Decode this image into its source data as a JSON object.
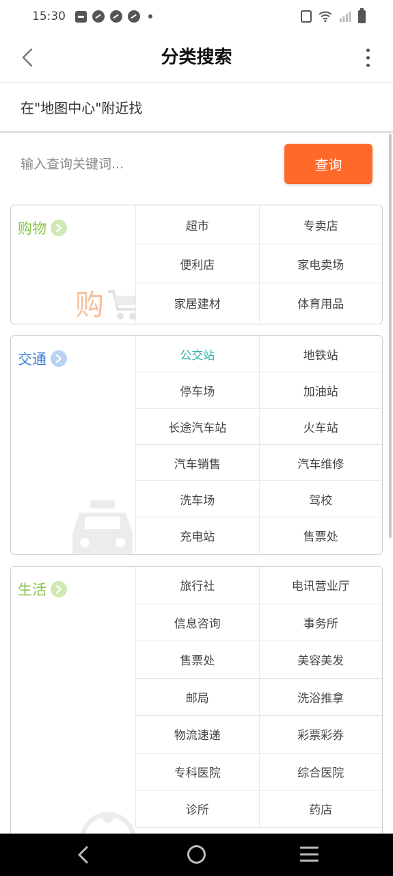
{
  "status_bar": {
    "time": "15:30"
  },
  "header": {
    "title": "分类搜索"
  },
  "location": {
    "text": "在\"地图中心\"附近找"
  },
  "search": {
    "placeholder": "输入查询关键词...",
    "button_label": "查询",
    "button_color": "#ff6a2a"
  },
  "categories": {
    "shopping": {
      "title": "购物",
      "color": "#8bc34a",
      "watermark_text": "购",
      "items": [
        "超市",
        "专卖店",
        "便利店",
        "家电卖场",
        "家居建材",
        "体育用品"
      ]
    },
    "transport": {
      "title": "交通",
      "color": "#3f7fd8",
      "active_item": "公交站",
      "active_color": "#2bb3a3",
      "items": [
        "公交站",
        "地铁站",
        "停车场",
        "加油站",
        "长途汽车站",
        "火车站",
        "汽车销售",
        "汽车维修",
        "洗车场",
        "驾校",
        "充电站",
        "售票处"
      ]
    },
    "life": {
      "title": "生活",
      "color": "#8bc34a",
      "items": [
        "旅行社",
        "电讯营业厅",
        "信息咨询",
        "事务所",
        "售票处",
        "美容美发",
        "邮局",
        "洗浴推拿",
        "物流速递",
        "彩票彩券",
        "专科医院",
        "综合医院",
        "诊所",
        "药店"
      ]
    }
  },
  "icons": {
    "back": "chevron-left-icon",
    "more": "more-vertical-icon",
    "nav_back": "nav-back-icon",
    "nav_home": "nav-home-icon",
    "nav_menu": "nav-menu-icon"
  }
}
